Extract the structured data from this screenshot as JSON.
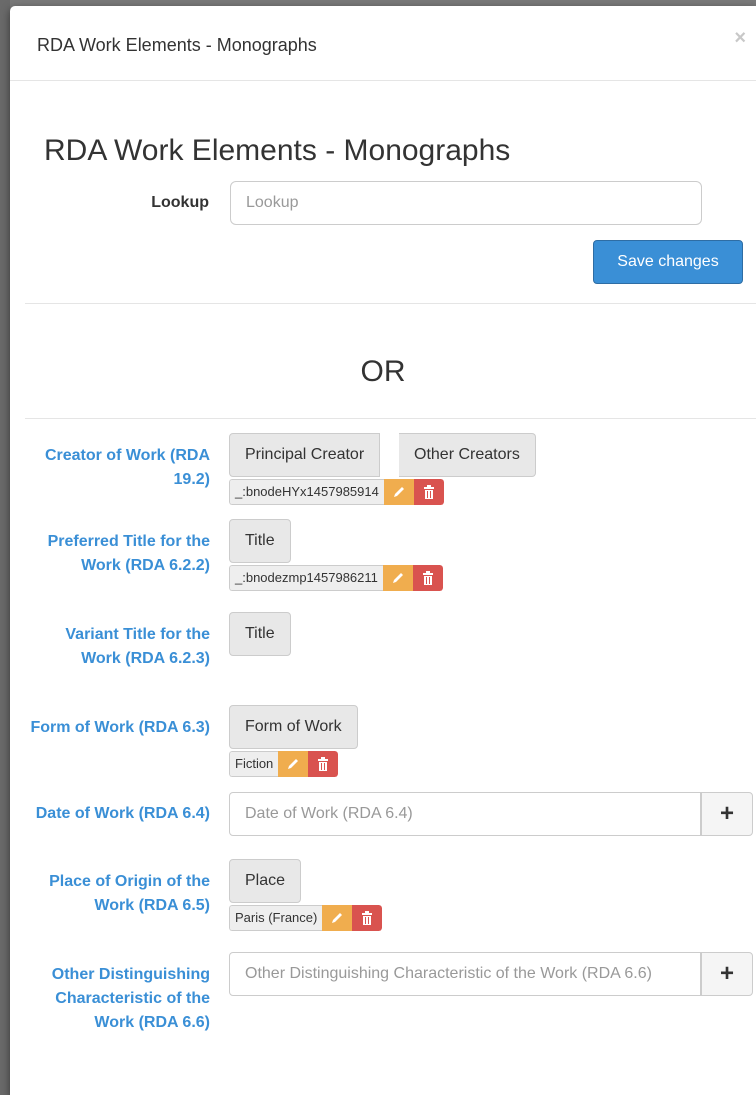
{
  "modal": {
    "title": "RDA Work Elements - Monographs",
    "close_symbol": "×"
  },
  "lookup": {
    "heading": "RDA Work Elements - Monographs",
    "label": "Lookup",
    "placeholder": "Lookup",
    "save_label": "Save changes"
  },
  "or_text": "OR",
  "fields": {
    "creator": {
      "label": "Creator of Work (RDA 19.2)",
      "buttons": [
        "Principal Creator",
        "Other Creators"
      ],
      "tag": "_:bnodeHYx1457985914"
    },
    "preferred_title": {
      "label": "Preferred Title for the Work (RDA 6.2.2)",
      "button": "Title",
      "tag": "_:bnodezmp1457986211"
    },
    "variant_title": {
      "label": "Variant Title for the Work (RDA 6.2.3)",
      "button": "Title"
    },
    "form": {
      "label": "Form of Work (RDA 6.3)",
      "button": "Form of Work",
      "tag": "Fiction"
    },
    "date": {
      "label": "Date of Work (RDA 6.4)",
      "placeholder": "Date of Work (RDA 6.4)",
      "add_label": "+"
    },
    "place": {
      "label": "Place of Origin of the Work (RDA 6.5)",
      "button": "Place",
      "tag": "Paris (France)"
    },
    "other": {
      "label": "Other Distinguishing Characteristic of the Work (RDA 6.6)",
      "placeholder": "Other Distinguishing Characteristic of the Work (RDA 6.6)",
      "add_label": "+"
    }
  },
  "icons": {
    "edit": "pencil-icon",
    "delete": "trash-icon"
  },
  "colors": {
    "primary": "#3a8fd6",
    "warning": "#f0ad4e",
    "danger": "#d9534f",
    "label": "#3a8fd6"
  }
}
